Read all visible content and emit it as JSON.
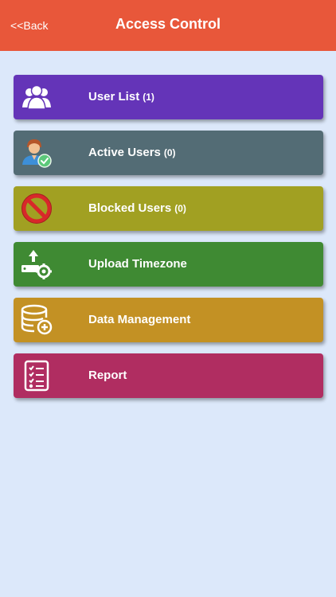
{
  "header": {
    "back_label": "<<Back",
    "title": "Access Control",
    "color": "#e8573a"
  },
  "menu": {
    "items": [
      {
        "label": "User List",
        "count": "(1)",
        "icon": "users-icon",
        "color": "#6434b8"
      },
      {
        "label": "Active Users",
        "count": "(0)",
        "icon": "active-user-icon",
        "color": "#536c75"
      },
      {
        "label": "Blocked Users",
        "count": "(0)",
        "icon": "blocked-icon",
        "color": "#a1a022"
      },
      {
        "label": "Upload Timezone",
        "count": "",
        "icon": "upload-settings-icon",
        "color": "#3f8a33"
      },
      {
        "label": "Data Management",
        "count": "",
        "icon": "database-add-icon",
        "color": "#c39124"
      },
      {
        "label": "Report",
        "count": "",
        "icon": "report-checklist-icon",
        "color": "#b02d61"
      }
    ]
  }
}
